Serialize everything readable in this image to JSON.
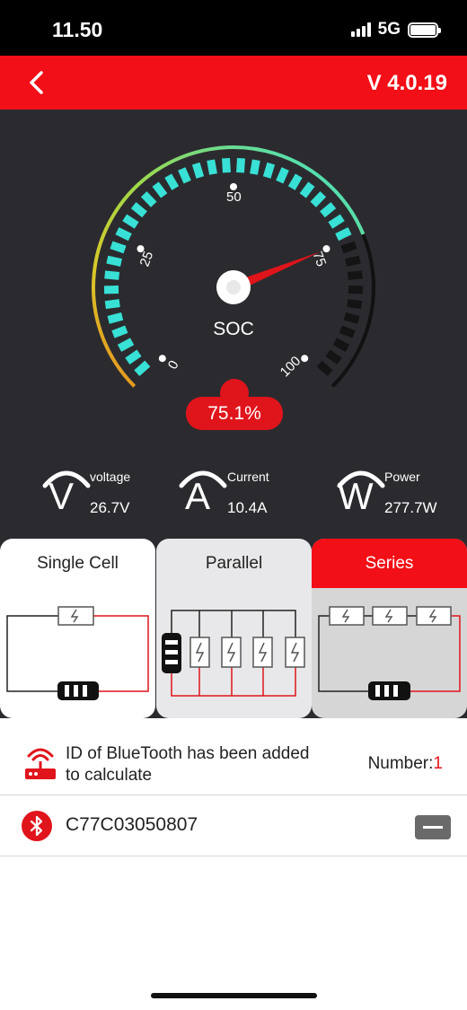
{
  "status": {
    "time": "11.50",
    "network": "5G"
  },
  "header": {
    "version": "V 4.0.19"
  },
  "gauge": {
    "label": "SOC",
    "soc_value": "75.1%",
    "soc_fraction": 0.751,
    "ticks": [
      "0",
      "25",
      "50",
      "75",
      "100"
    ]
  },
  "metrics": [
    {
      "symbol": "V",
      "label": "voltage",
      "value": "26.7V"
    },
    {
      "symbol": "A",
      "label": "Current",
      "value": "10.4A"
    },
    {
      "symbol": "W",
      "label": "Power",
      "value": "277.7W"
    }
  ],
  "tabs": [
    {
      "label": "Single Cell",
      "selected": false
    },
    {
      "label": "Parallel",
      "selected": false
    },
    {
      "label": "Series",
      "selected": true
    }
  ],
  "bluetooth": {
    "info": "ID of BlueTooth has been added to calculate",
    "number_label": "Number:",
    "number": "1",
    "devices": [
      {
        "id": "C77C03050807"
      }
    ]
  },
  "colors": {
    "accent": "#f20f17",
    "gauge_active": "#38e0d5",
    "dark_bg": "#2b2b2f"
  }
}
